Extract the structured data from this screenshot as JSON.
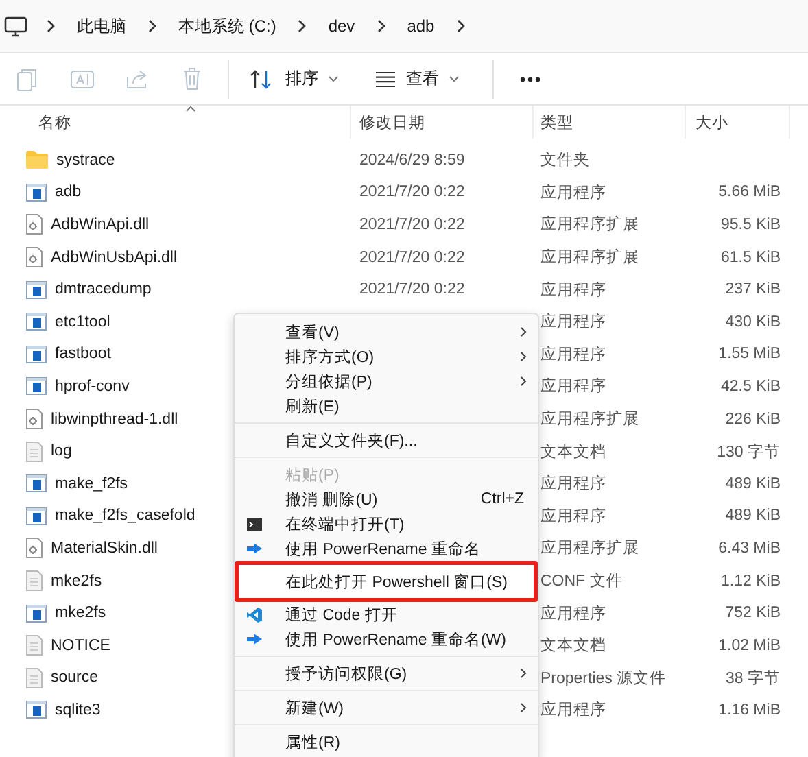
{
  "breadcrumb": [
    "此电脑",
    "本地系统 (C:)",
    "dev",
    "adb"
  ],
  "toolbar": {
    "icon_buttons": [
      {
        "disabled": true
      },
      {
        "disabled": true
      },
      {
        "disabled": true
      },
      {
        "disabled": true
      }
    ],
    "sort_button": {
      "label": "排序"
    },
    "view_button": {
      "label": "查看"
    }
  },
  "columns": [
    "名称",
    "修改日期",
    "类型",
    "大小"
  ],
  "rows": [
    {
      "name": "systrace",
      "kind": "folder",
      "date": "2024/6/29 8:59",
      "type": "文件夹"
    },
    {
      "name": "adb",
      "kind": "app",
      "date": "2021/7/20 0:22",
      "type": "应用程序",
      "size": "5.66 MiB"
    },
    {
      "name": "AdbWinApi.dll",
      "kind": "dll",
      "date": "2021/7/20 0:22",
      "type": "应用程序扩展",
      "size": "95.5 KiB"
    },
    {
      "name": "AdbWinUsbApi.dll",
      "kind": "dll",
      "date": "2021/7/20 0:22",
      "type": "应用程序扩展",
      "size": "61.5 KiB"
    },
    {
      "name": "dmtracedump",
      "kind": "app",
      "date": "2021/7/20 0:22",
      "type": "应用程序",
      "size": "237 KiB"
    },
    {
      "name": "etc1tool",
      "kind": "app",
      "type": "应用程序",
      "size": "430 KiB"
    },
    {
      "name": "fastboot",
      "kind": "app",
      "type": "应用程序",
      "size": "1.55 MiB"
    },
    {
      "name": "hprof-conv",
      "kind": "app",
      "type": "应用程序",
      "size": "42.5 KiB"
    },
    {
      "name": "libwinpthread-1.dll",
      "kind": "dll",
      "type": "应用程序扩展",
      "size": "226 KiB"
    },
    {
      "name": "log",
      "kind": "text",
      "type": "文本文档",
      "size": "130 字节"
    },
    {
      "name": "make_f2fs",
      "kind": "app",
      "type": "应用程序",
      "size": "489 KiB"
    },
    {
      "name": "make_f2fs_casefold",
      "kind": "app",
      "type": "应用程序",
      "size": "489 KiB"
    },
    {
      "name": "MaterialSkin.dll",
      "kind": "dll",
      "type": "应用程序扩展",
      "size": "6.43 MiB"
    },
    {
      "name": "mke2fs",
      "kind": "text",
      "type": "CONF 文件",
      "size": "1.12 KiB"
    },
    {
      "name": "mke2fs",
      "kind": "app",
      "type": "应用程序",
      "size": "752 KiB"
    },
    {
      "name": "NOTICE",
      "kind": "text",
      "type": "文本文档",
      "size": "1.02 MiB"
    },
    {
      "name": "source",
      "kind": "text",
      "type": "Properties 源文件",
      "size": "38 字节"
    },
    {
      "name": "sqlite3",
      "kind": "app",
      "type": "应用程序",
      "size": "1.16 MiB"
    }
  ],
  "context_menu": [
    {
      "kind": "item",
      "label": "查看(V)",
      "submenu": true
    },
    {
      "kind": "item",
      "label": "排序方式(O)",
      "submenu": true
    },
    {
      "kind": "item",
      "label": "分组依据(P)",
      "submenu": true
    },
    {
      "kind": "item",
      "label": "刷新(E)"
    },
    {
      "kind": "separator"
    },
    {
      "kind": "item",
      "label": "自定义文件夹(F)..."
    },
    {
      "kind": "separator"
    },
    {
      "kind": "item",
      "label": "粘贴(P)",
      "disabled": true
    },
    {
      "kind": "item",
      "label": "撤消 删除(U)",
      "shortcut": "Ctrl+Z"
    },
    {
      "kind": "terminal",
      "label": "在终端中打开(T)"
    },
    {
      "kind": "rename",
      "label": "使用 PowerRename 重命名"
    },
    {
      "kind": "item",
      "label": "在此处打开 Powershell 窗口(S)",
      "highlighted": true
    },
    {
      "kind": "code",
      "label": "通过 Code 打开"
    },
    {
      "kind": "rename",
      "label": "使用 PowerRename 重命名(W)"
    },
    {
      "kind": "separator"
    },
    {
      "kind": "item",
      "label": "授予访问权限(G)",
      "submenu": true
    },
    {
      "kind": "separator"
    },
    {
      "kind": "item",
      "label": "新建(W)",
      "submenu": true
    },
    {
      "kind": "separator"
    },
    {
      "kind": "item",
      "label": "属性(R)"
    }
  ]
}
